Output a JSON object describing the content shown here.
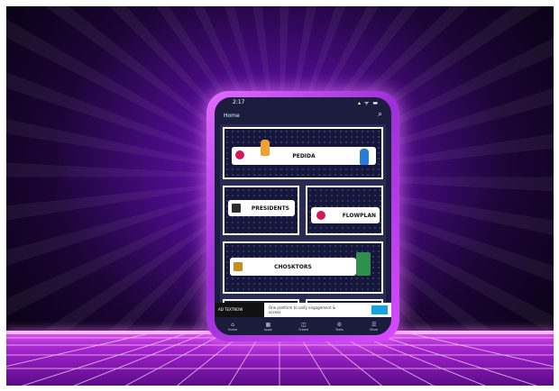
{
  "status": {
    "time": "2:17",
    "icons": "▴ ᯤ ▬"
  },
  "appbar": {
    "title": "Home",
    "search_icon": "search-icon"
  },
  "cards": [
    {
      "label": "PEDIDA"
    },
    {
      "label": "PRESIDENTS"
    },
    {
      "label": "FLOWPLAN"
    },
    {
      "label": "CHOSKTORS"
    }
  ],
  "ad": {
    "brand": "AD TEXTNOW",
    "text": "One platform to unify engagement & access",
    "cta": ""
  },
  "nav": [
    {
      "label": "Home",
      "icon": "home-icon"
    },
    {
      "label": "Apps",
      "icon": "grid-icon"
    },
    {
      "label": "Frame",
      "icon": "frame-icon"
    },
    {
      "label": "Tools",
      "icon": "tools-icon"
    },
    {
      "label": "More",
      "icon": "more-icon"
    }
  ],
  "colors": {
    "accent": "#d84cff",
    "background": "#4a0b86",
    "screen": "#1b1c3e",
    "badge": "#d21a5a"
  }
}
